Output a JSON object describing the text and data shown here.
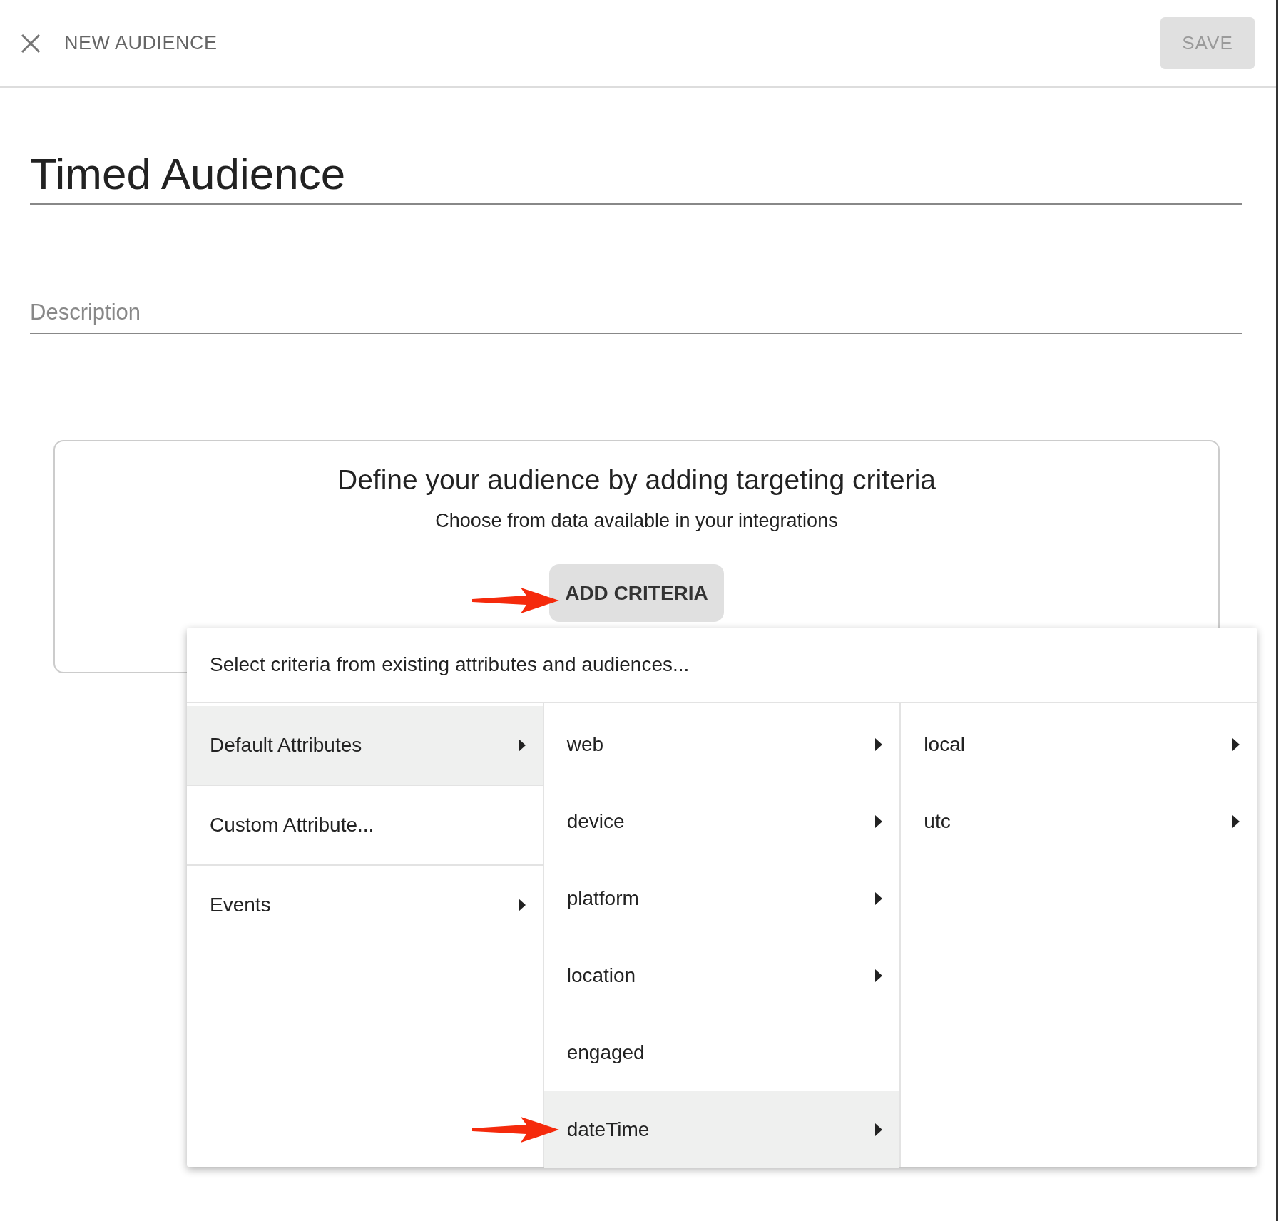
{
  "header": {
    "title": "NEW AUDIENCE",
    "save_button": {
      "label": "SAVE",
      "disabled": true
    }
  },
  "name_field": {
    "value": "Timed Audience"
  },
  "description_field": {
    "placeholder": "Description"
  },
  "criteria_card": {
    "heading": "Define your audience by adding targeting criteria",
    "subheading": "Choose from data available in your integrations",
    "button": "ADD CRITERIA"
  },
  "menu": {
    "header": "Select criteria from existing attributes and audiences...",
    "columns": [
      {
        "items": [
          {
            "label": "Default Attributes",
            "selected": true,
            "submenu": true
          },
          {
            "label": "Custom Attribute...",
            "selected": false,
            "submenu": false
          },
          {
            "label": "Events",
            "selected": false,
            "submenu": true
          }
        ]
      },
      {
        "items": [
          {
            "label": "web",
            "selected": false,
            "submenu": true
          },
          {
            "label": "device",
            "selected": false,
            "submenu": true
          },
          {
            "label": "platform",
            "selected": false,
            "submenu": true
          },
          {
            "label": "location",
            "selected": false,
            "submenu": true
          },
          {
            "label": "engaged",
            "selected": false,
            "submenu": false
          },
          {
            "label": "dateTime",
            "selected": true,
            "submenu": true
          }
        ]
      },
      {
        "items": [
          {
            "label": "local",
            "selected": false,
            "submenu": true
          },
          {
            "label": "utc",
            "selected": false,
            "submenu": true
          }
        ]
      }
    ]
  }
}
